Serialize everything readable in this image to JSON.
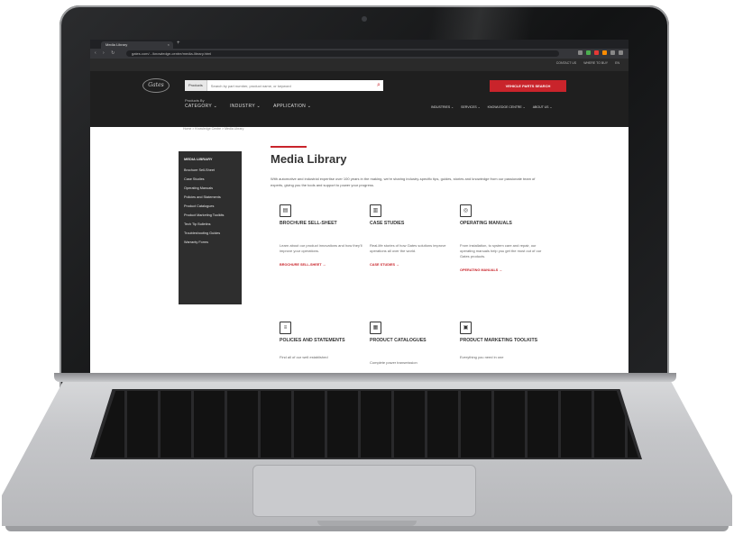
{
  "browser": {
    "tab_title": "Media Library",
    "tab_close": "×",
    "new_tab": "+",
    "nav_icons": "‹ › ↻",
    "url": "gates.com/.../knowledge-centre/media-library.html"
  },
  "site": {
    "logo": "Gates",
    "utility_links": [
      "CONTACT US",
      "WHERE TO BUY",
      "EN"
    ],
    "search": {
      "category": "Products",
      "placeholder": "Search by part number, product name, or keyword"
    },
    "parts_button": "VEHICLE PARTS SEARCH",
    "products_by": "Products By",
    "main_nav": [
      "CATEGORY ⌄",
      "INDUSTRY ⌄",
      "APPLICATION ⌄"
    ],
    "secondary_nav": [
      "INDUSTRIES ⌄",
      "SERVICES ⌄",
      "KNOWLEDGE CENTRE ⌄",
      "ABOUT US ⌄"
    ]
  },
  "breadcrumb": "Home  >  Knowledge Centre  >  Media Library",
  "sidebar": {
    "title": "MEDIA LIBRARY",
    "items": [
      "Brochure Sell-Sheet",
      "Case Studies",
      "Operating Manuals",
      "Policies and Statements",
      "Product Catalogues",
      "Product Marketing Toolkits",
      "Tech Tip Bulletins",
      "Troubleshooting Guides",
      "Warranty Forms"
    ]
  },
  "page": {
    "title": "Media Library",
    "intro": "With automotive and industrial expertise over 100 years in the making, we're sharing industry-specific tips, guides, stories and knowledge from our passionate team of experts, giving you the tools and support to power your progress."
  },
  "cards": [
    {
      "icon": "brochure-icon",
      "glyph": "▤",
      "title": "BROCHURE SELL-SHEET",
      "desc": "Learn about our product innovations and how they'll improve your operations.",
      "link": "BROCHURE SELL-SHEET →"
    },
    {
      "icon": "chart-icon",
      "glyph": "▥",
      "title": "CASE STUDIES",
      "desc": "Real-life stories of how Gates solutions improve operations all over the world.",
      "link": "CASE STUDIES →"
    },
    {
      "icon": "manual-icon",
      "glyph": "◎",
      "title": "OPERATING MANUALS",
      "desc": "From installation, to system care and repair, our operating manuals help you get the most out of our Gates products.",
      "link": "OPERATING MANUALS →"
    },
    {
      "icon": "policy-icon",
      "glyph": "≡",
      "title": "POLICIES AND STATEMENTS",
      "desc": "Find all of our well established",
      "link": ""
    },
    {
      "icon": "catalogue-icon",
      "glyph": "▦",
      "title": "PRODUCT CATALOGUES",
      "desc": "Complete power transmission",
      "link": ""
    },
    {
      "icon": "toolkit-icon",
      "glyph": "▣",
      "title": "PRODUCT MARKETING TOOLKITS",
      "desc": "Everything you need in one",
      "link": ""
    }
  ]
}
